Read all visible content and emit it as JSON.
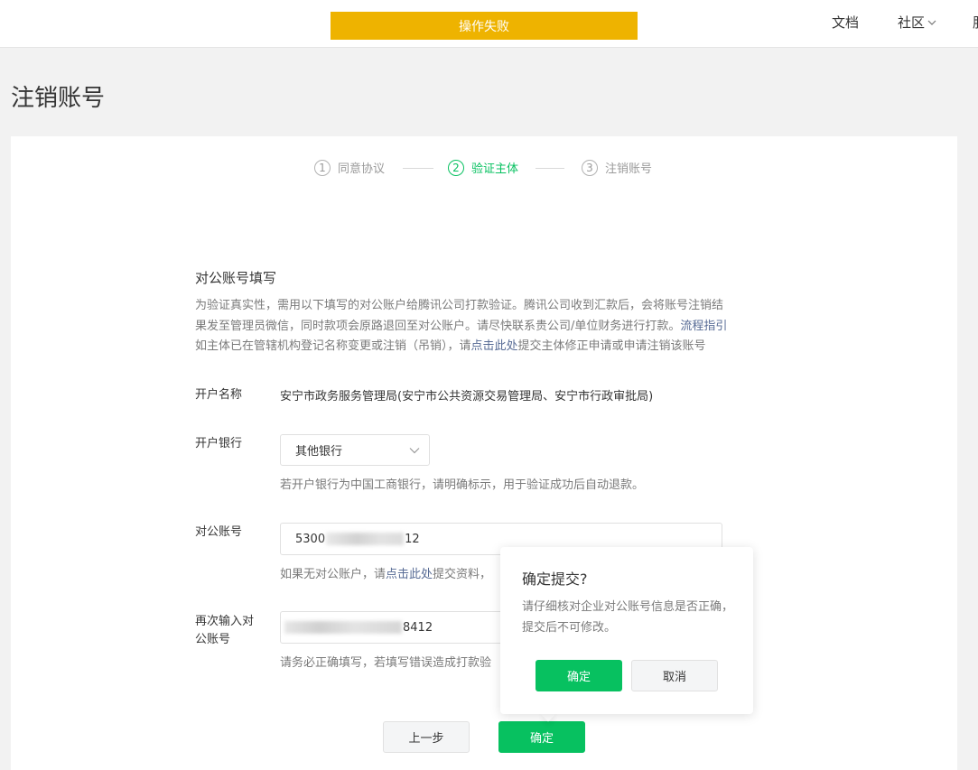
{
  "toast": {
    "text": "操作失败",
    "color": "#eeb300"
  },
  "nav": {
    "docs": "文档",
    "community": "社区",
    "cut_item": "服"
  },
  "page_title": "注销账号",
  "steps": [
    {
      "num": "1",
      "label": "同意协议",
      "state": "done"
    },
    {
      "num": "2",
      "label": "验证主体",
      "state": "active"
    },
    {
      "num": "3",
      "label": "注销账号",
      "state": "pending"
    }
  ],
  "form": {
    "section_title": "对公账号填写",
    "desc_line1": "为验证真实性，需用以下填写的对公账户给腾讯公司打款验证。腾讯公司收到汇款后，会将账号注销结",
    "desc_line2_a": "果发至管理员微信，同时款项会原路退回至对公账户。请尽快联系贵公司/单位财务进行打款。",
    "desc_line2_link": "流程指引",
    "desc_line3_a": "如主体已在管辖机构登记名称变更或注销（吊销），请",
    "desc_line3_link": "点击此处",
    "desc_line3_b": "提交主体修正申请或申请注销该账号",
    "account_name_label": "开户名称",
    "account_name_value": "安宁市政务服务管理局(安宁市公共资源交易管理局、安宁市行政审批局)",
    "bank_label": "开户银行",
    "bank_value": "其他银行",
    "bank_hint": "若开户银行为中国工商银行，请明确标示，用于验证成功后自动退款。",
    "account_label": "对公账号",
    "account_prefix": "5300",
    "account_suffix": "12",
    "account_hint_a": "如果无对公账户，请",
    "account_hint_link": "点击此处",
    "account_hint_b": "提交资料，",
    "reenter_label_1": "再次输入对",
    "reenter_label_2": "公账号",
    "reenter_suffix": "8412",
    "reenter_hint": "请务必正确填写，若填写错误造成打款验"
  },
  "buttons": {
    "prev": "上一步",
    "confirm": "确定"
  },
  "popover": {
    "title": "确定提交?",
    "body": "请仔细核对企业对公账号信息是否正确，提交后不可修改。",
    "ok": "确定",
    "cancel": "取消"
  },
  "colors": {
    "primary": "#07c160",
    "link": "#576b95"
  }
}
